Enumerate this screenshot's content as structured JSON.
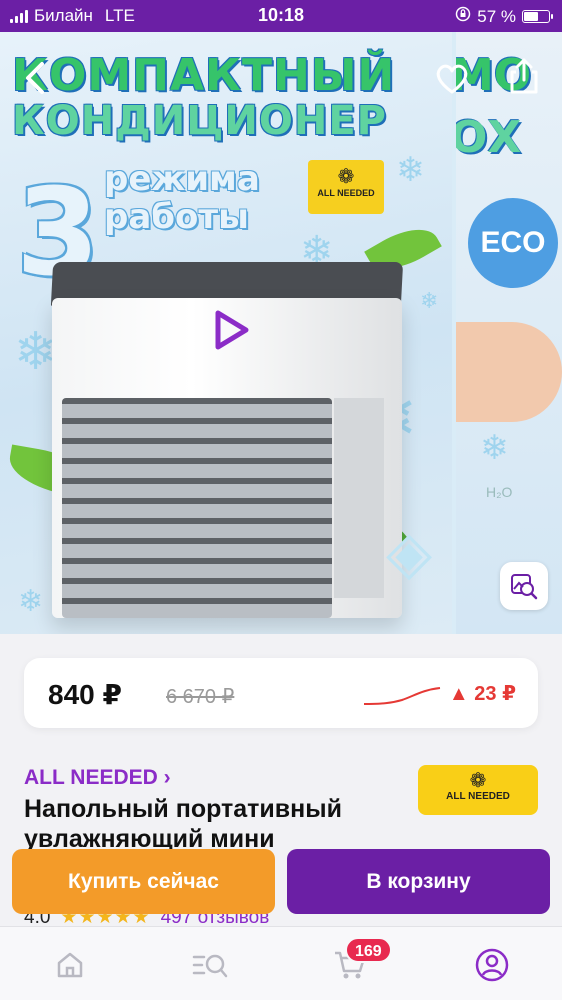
{
  "status_bar": {
    "carrier": "Билайн",
    "network": "LTE",
    "time": "10:18",
    "battery": "57 %",
    "battery_level": 0.57
  },
  "gallery": {
    "headline_line1": "КОМПАКТНЫЙ",
    "headline_line2": "КОНДИЦИОНЕР",
    "big_number": "3",
    "modes_line1": "режима",
    "modes_line2": "работы",
    "sticker_brand": "ALL NEEDED",
    "next_slide_title1": "МО",
    "next_slide_title2": "ОХ",
    "next_slide_eco": "ECO",
    "next_slide_h2o": "H₂O"
  },
  "price": {
    "current": "840 ₽",
    "old": "6 670 ₽",
    "delta": "▲ 23 ₽",
    "accent": "#e53935"
  },
  "product": {
    "brand_link": "ALL NEEDED ›",
    "title": "Напольный портативный увлажняющий мини",
    "brand_badge": "ALL NEEDED",
    "rating": "4.0",
    "stars": "★★★★★",
    "reviews": "497 отзывов"
  },
  "actions": {
    "buy_now": "Купить сейчас",
    "add_to_cart": "В корзину"
  },
  "tab_bar": {
    "cart_count": "169"
  },
  "colors": {
    "brand_purple": "#6b1fa5",
    "buy_orange": "#f39b29",
    "badge_yellow": "#f9cf17"
  }
}
